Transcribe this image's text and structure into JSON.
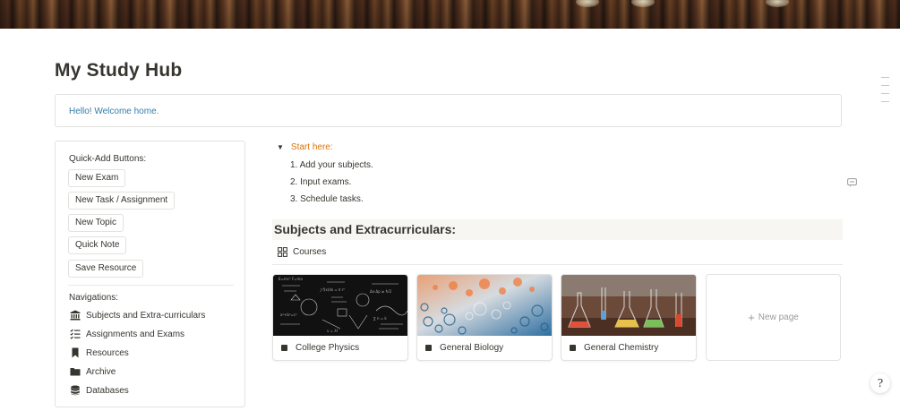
{
  "page": {
    "title": "My Study Hub",
    "cover_icon": "bookshelf-cover-image"
  },
  "callout": {
    "text": "Hello! Welcome home."
  },
  "quick_add": {
    "heading": "Quick-Add Buttons:",
    "buttons": [
      {
        "label": "New Exam"
      },
      {
        "label": "New Task / Assignment"
      },
      {
        "label": "New Topic"
      },
      {
        "label": "Quick Note"
      },
      {
        "label": "Save Resource"
      }
    ]
  },
  "navigation": {
    "heading": "Navigations:",
    "items": [
      {
        "label": "Subjects and Extra-curriculars",
        "icon": "institution-icon"
      },
      {
        "label": "Assignments and Exams",
        "icon": "checklist-icon"
      },
      {
        "label": "Resources",
        "icon": "bookmark-icon"
      },
      {
        "label": "Archive",
        "icon": "folder-icon"
      },
      {
        "label": "Databases",
        "icon": "database-icon"
      }
    ]
  },
  "start_here": {
    "toggle_label": "Start here:",
    "toggle_color": "#d9730d",
    "steps": [
      "1. Add your subjects.",
      "2. Input exams.",
      "3. Schedule tasks."
    ]
  },
  "subjects_section": {
    "heading": "Subjects and Extracurriculars:",
    "view_tab": "Courses",
    "view_icon": "gallery-grid-icon",
    "cards": [
      {
        "title": "College Physics",
        "cover": "chalkboard-equations"
      },
      {
        "title": "General Biology",
        "cover": "cell-texture"
      },
      {
        "title": "General Chemistry",
        "cover": "lab-glassware"
      }
    ],
    "new_page_label": "New page"
  },
  "colors": {
    "text": "#37352f",
    "link_blue": "#337ea9",
    "orange": "#d9730d",
    "border": "#e3e2e0",
    "muted": "#9b9a97"
  },
  "help": {
    "icon": "help-sigma-icon",
    "glyph": "?"
  }
}
